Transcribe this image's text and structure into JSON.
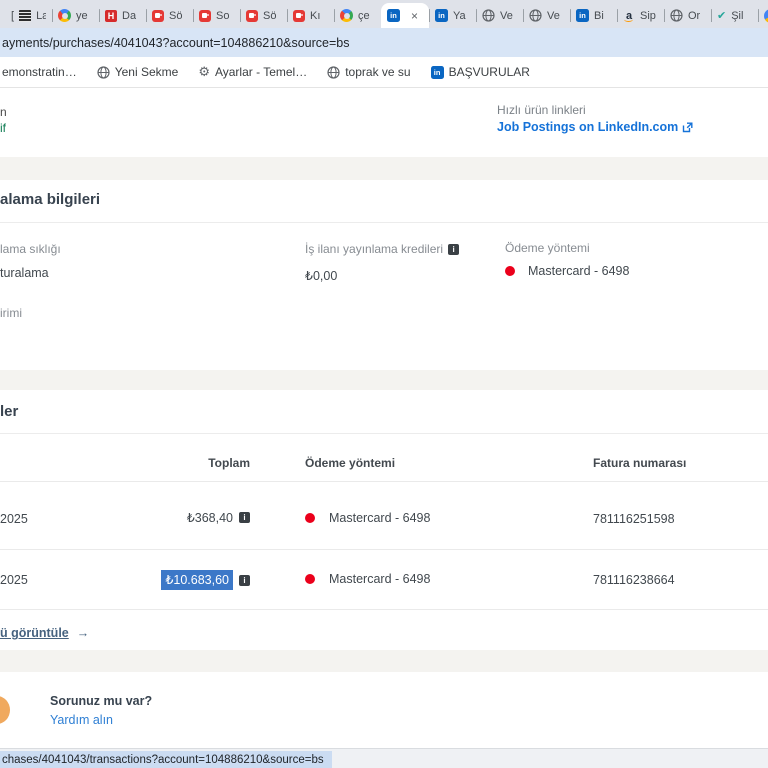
{
  "icons": {
    "linkedin_glyph": "in",
    "google_glyph": "G",
    "h_glyph": "H",
    "amazon_glyph": "a",
    "check_glyph": "✔",
    "gear_glyph": "⚙",
    "close_glyph": "×",
    "arrow_glyph": "→",
    "info_glyph": "i",
    "bracket_glyph": "["
  },
  "browser": {
    "tabs": [
      {
        "label": "La",
        "icon": "document"
      },
      {
        "label": "ye",
        "icon": "google"
      },
      {
        "label": "Da",
        "icon": "red-h"
      },
      {
        "label": "Sö",
        "icon": "red-app"
      },
      {
        "label": "So",
        "icon": "red-app"
      },
      {
        "label": "Sö",
        "icon": "red-app"
      },
      {
        "label": "Kı",
        "icon": "red-app"
      },
      {
        "label": "çe",
        "icon": "google"
      },
      {
        "label": "",
        "icon": "linkedin",
        "active": true
      },
      {
        "label": "Ya",
        "icon": "linkedin"
      },
      {
        "label": "Ve",
        "icon": "globe"
      },
      {
        "label": "Ve",
        "icon": "globe"
      },
      {
        "label": "Bi",
        "icon": "linkedin"
      },
      {
        "label": "Sip",
        "icon": "amazon"
      },
      {
        "label": "Or",
        "icon": "globe"
      },
      {
        "label": "Şil",
        "icon": "check"
      },
      {
        "label": "",
        "icon": "partial"
      }
    ],
    "url": "ayments/purchases/4041043?account=104886210&source=bs",
    "bookmarks": [
      {
        "label": "emonstratin…"
      },
      {
        "label": "Yeni Sekme"
      },
      {
        "label": "Ayarlar - Temel…"
      },
      {
        "label": "toprak ve su"
      },
      {
        "label": "BAŞVURULAR"
      }
    ],
    "status_url": "chases/4041043/transactions?account=104886210&source=bs"
  },
  "page": {
    "product_card": {
      "fragment_line": "n",
      "status_fragment": "if",
      "quick_links_label": "Hızlı ürün linkleri",
      "quick_link": "Job Postings on LinkedIn.com"
    },
    "billing": {
      "heading_fragment": "alama bilgileri",
      "frequency_label": "lama sıklığı",
      "frequency_value": "turalama",
      "credits_label": "İş ilanı yayınlama kredileri",
      "credits_value": "₺0,00",
      "payment_label": "Ödeme yöntemi",
      "payment_value": "Mastercard - 6498",
      "currency_label_fragment": "irimi"
    },
    "transactions": {
      "heading_fragment": "ler",
      "columns": {
        "total": "Toplam",
        "method": "Ödeme yöntemi",
        "invoice": "Fatura numarası"
      },
      "rows": [
        {
          "date_fragment": "2025",
          "total": "₺368,40",
          "method": "Mastercard - 6498",
          "invoice": "781116251598"
        },
        {
          "date_fragment": "2025",
          "total": "₺10.683,60",
          "method": "Mastercard - 6498",
          "invoice": "781116238664"
        }
      ],
      "view_all_fragment": "ü görüntüle",
      "view_all_arrow": "→"
    },
    "help": {
      "question": "Sorunuz mu var?",
      "link": "Yardım alın"
    }
  },
  "colors": {
    "linkedin_blue": "#0a66c2",
    "link_blue": "#1572d8",
    "selection_blue": "#3c78c8",
    "mastercard_red": "#eb001b",
    "mastercard_orange": "#f79e1b",
    "status_green": "#0c7a50"
  }
}
